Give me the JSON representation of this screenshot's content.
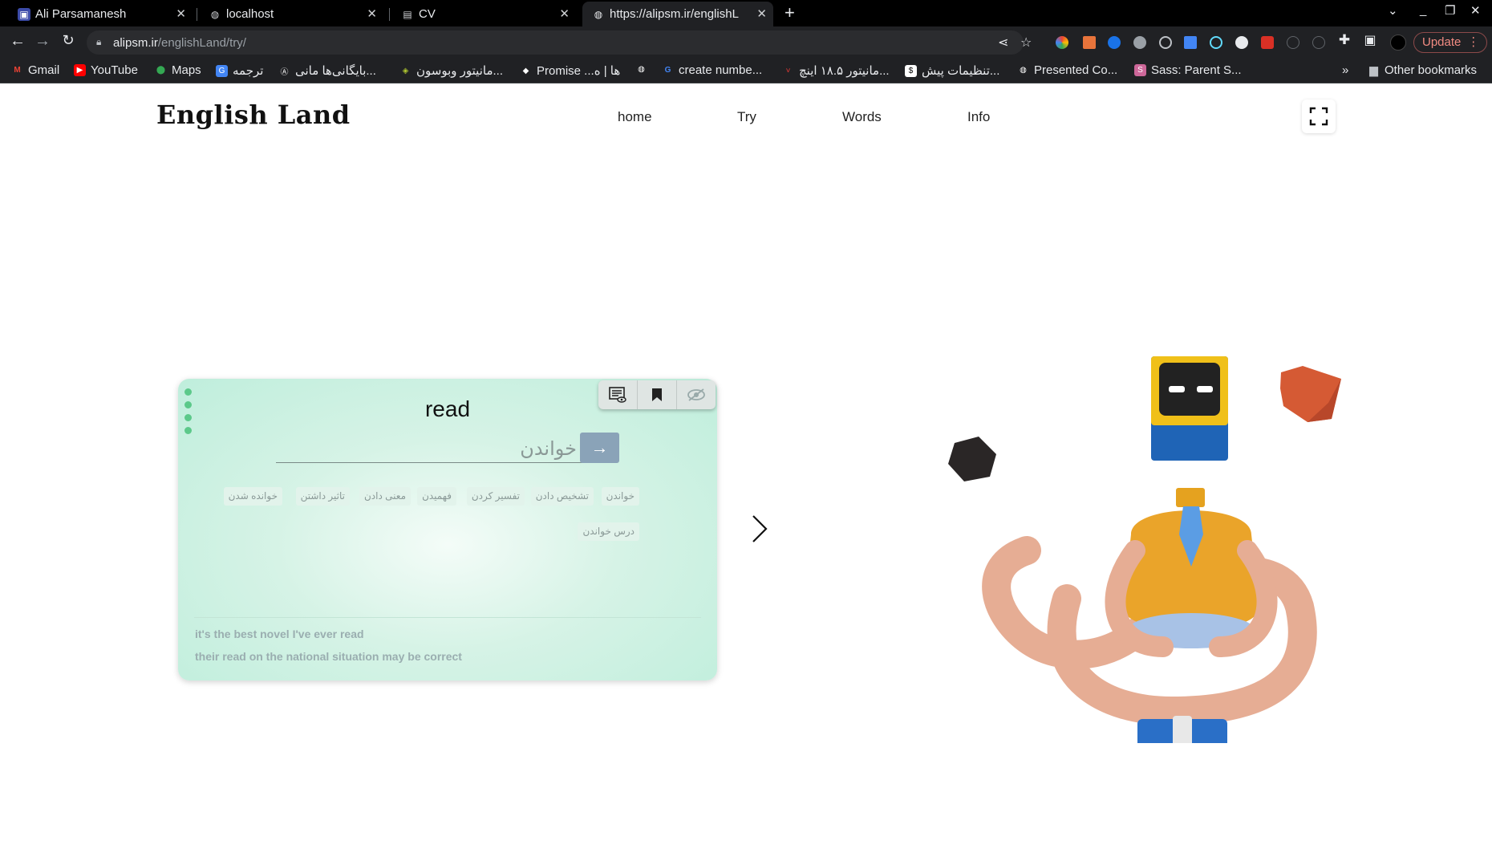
{
  "browser": {
    "tabs": [
      {
        "title": "Ali Parsamanesh",
        "icon": "profile-icon"
      },
      {
        "title": "localhost",
        "icon": "globe-icon"
      },
      {
        "title": "CV",
        "icon": "document-icon"
      },
      {
        "title": "https://alipsm.ir/englishL",
        "icon": "globe-icon"
      }
    ],
    "url_host": "alipsm.ir",
    "url_path": "/englishLand/try/",
    "update_label": "Update",
    "bookmarks": [
      {
        "label": "Gmail",
        "color": "#ea4335"
      },
      {
        "label": "YouTube",
        "color": "#ff0000"
      },
      {
        "label": "Maps",
        "color": "#34a853"
      },
      {
        "label": "ترجمه",
        "color": "#4285f4"
      },
      {
        "label": "بایگانی‌ها مانی...",
        "color": "#ffffff"
      },
      {
        "label": "مانیتور وبوسون...",
        "color": "#b0c830"
      },
      {
        "label": "Promise ...ها | ه",
        "color": "#222222"
      },
      {
        "label": "",
        "color": "#ffffff"
      },
      {
        "label": "create numbe...",
        "color": "#4285f4"
      },
      {
        "label": "مانیتور ۱۸.۵ اینچ...",
        "color": "#e53935"
      },
      {
        "label": "تنظیمات پیش...",
        "color": "#ffffff"
      },
      {
        "label": "Presented Co...",
        "color": "#ffffff"
      },
      {
        "label": "Sass: Parent S...",
        "color": "#cd6799"
      }
    ],
    "more_bookmarks": "»",
    "other_bookmarks": "Other bookmarks"
  },
  "site": {
    "logo": "English Land",
    "nav": [
      "home",
      "Try",
      "Words",
      "Info"
    ]
  },
  "card": {
    "word": "read",
    "answer": "خواندن",
    "tool_icons": [
      "subtitles-eye-icon",
      "bookmark-icon",
      "eye-off-icon"
    ],
    "meanings_row1": [
      "خواندن",
      "تشخیص دادن",
      "تفسیر کردن",
      "فهمیدن",
      "معنی دادن",
      "تاثیر داشتن",
      "خوانده شدن"
    ],
    "meanings_row2": [
      "درس خواندن"
    ],
    "examples": [
      "it's the best novel I've ever read",
      "their read on the national situation may be correct"
    ]
  },
  "colors": {
    "card_bg": "#c9f1e0",
    "dots": "#5cc98a",
    "go_button": "#8aa3b8"
  }
}
